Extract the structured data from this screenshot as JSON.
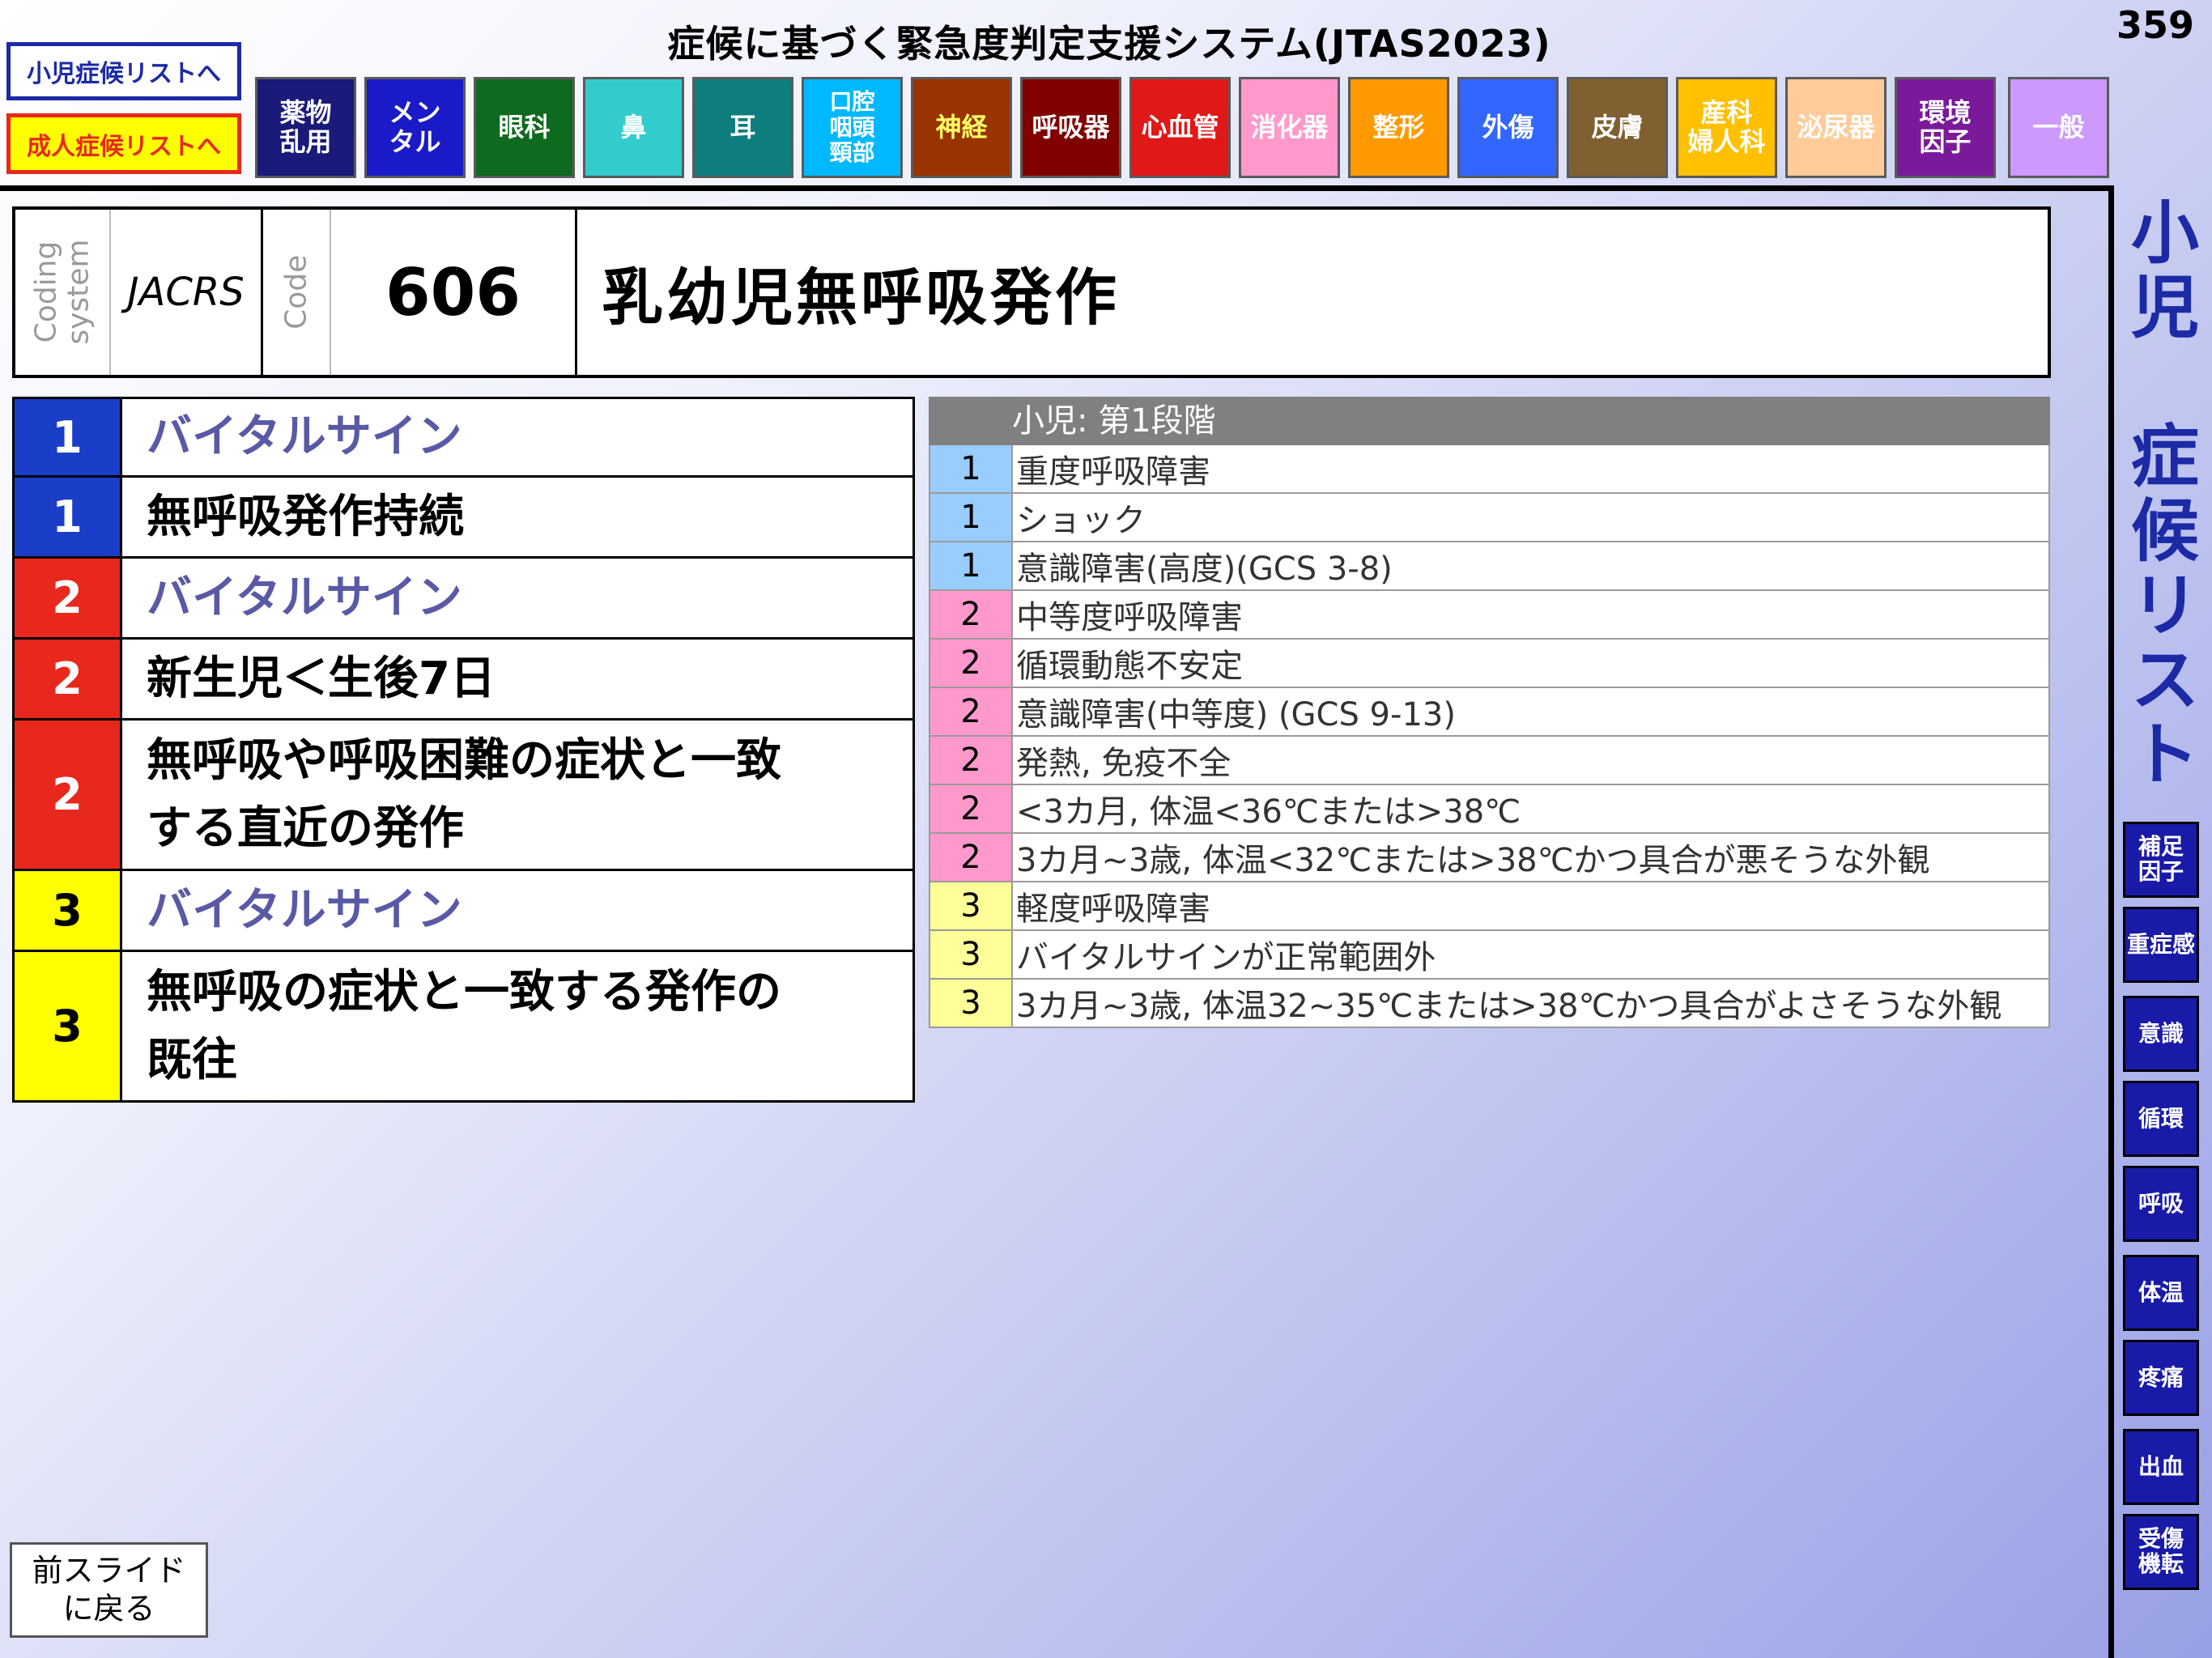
{
  "header": {
    "title": "症候に基づく緊急度判定支援システム(JTAS2023)",
    "slide_number": "359"
  },
  "nav": {
    "child_list": "小児症候リストへ",
    "adult_list": "成人症候リストへ"
  },
  "categories": [
    {
      "label": "薬物\n乱用",
      "bg": "#1a1a7a",
      "fg": "#ffffff"
    },
    {
      "label": "メン\nタル",
      "bg": "#1a1ac8",
      "fg": "#ffffff"
    },
    {
      "label": "眼科",
      "bg": "#0e6a1e",
      "fg": "#ffffff"
    },
    {
      "label": "鼻",
      "bg": "#33cccc",
      "fg": "#ffffff"
    },
    {
      "label": "耳",
      "bg": "#0e7d7d",
      "fg": "#ffffff"
    },
    {
      "label": "口腔\n咽頭\n頸部",
      "bg": "#00b8ff",
      "fg": "#ffffff"
    },
    {
      "label": "神経",
      "bg": "#993300",
      "fg": "#ffff66"
    },
    {
      "label": "呼吸器",
      "bg": "#800000",
      "fg": "#ffffff"
    },
    {
      "label": "心血管",
      "bg": "#e01818",
      "fg": "#ffffff"
    },
    {
      "label": "消化器",
      "bg": "#ff99cc",
      "fg": "#ffffff"
    },
    {
      "label": "整形",
      "bg": "#ff9900",
      "fg": "#ffffff"
    },
    {
      "label": "外傷",
      "bg": "#3366ff",
      "fg": "#ffffff"
    },
    {
      "label": "皮膚",
      "bg": "#806030",
      "fg": "#ffffff"
    },
    {
      "label": "産科\n婦人科",
      "bg": "#ffc000",
      "fg": "#ffffff"
    },
    {
      "label": "泌尿器",
      "bg": "#ffcc99",
      "fg": "#ffffff"
    },
    {
      "label": "環境\n因子",
      "bg": "#7a1a9a",
      "fg": "#ffffff"
    },
    {
      "label": "一般",
      "bg": "#cc99ff",
      "fg": "#ffffff"
    }
  ],
  "side": {
    "title": "小\n児\n\n症\n候\nリ\nス\nト",
    "buttons": [
      "補足\n因子",
      "重症感",
      "意識",
      "循環",
      "呼吸",
      "体温",
      "疼痛",
      "出血",
      "受傷\n機転"
    ]
  },
  "code": {
    "coding_system_label": "Coding\nsystem",
    "system": "JACRS",
    "code_label": "Code",
    "number": "606",
    "complaint": "乳幼児無呼吸発作"
  },
  "criteria": [
    {
      "level": "1",
      "text": "バイタルサイン",
      "vital": true
    },
    {
      "level": "1",
      "text": "無呼吸発作持続",
      "vital": false
    },
    {
      "level": "2",
      "text": "バイタルサイン",
      "vital": true
    },
    {
      "level": "2",
      "text": "新生児＜生後7日",
      "vital": false
    },
    {
      "level": "2",
      "text": "無呼吸や呼吸困難の症状と一致\nする直近の発作",
      "vital": false
    },
    {
      "level": "3",
      "text": "バイタルサイン",
      "vital": true
    },
    {
      "level": "3",
      "text": "無呼吸の症状と一致する発作の\n既往",
      "vital": false
    }
  ],
  "level_colors": {
    "1": "#1a3ec8",
    "2": "#e8281d",
    "3": "#ffff00"
  },
  "modifiers": {
    "header": "小児: 第1段階",
    "rows": [
      {
        "level": "1",
        "text": "重度呼吸障害"
      },
      {
        "level": "1",
        "text": "ショック"
      },
      {
        "level": "1",
        "text": "意識障害(高度)(GCS 3-8)"
      },
      {
        "level": "2",
        "text": "中等度呼吸障害"
      },
      {
        "level": "2",
        "text": "循環動態不安定"
      },
      {
        "level": "2",
        "text": "意識障害(中等度) (GCS 9-13)"
      },
      {
        "level": "2",
        "text": "発熱, 免疫不全"
      },
      {
        "level": "2",
        "text": "<3カ月, 体温<36℃または>38℃"
      },
      {
        "level": "2",
        "text": "3カ月~3歳, 体温<32℃または>38℃かつ具合が悪そうな外観"
      },
      {
        "level": "3",
        "text": "軽度呼吸障害"
      },
      {
        "level": "3",
        "text": "バイタルサインが正常範囲外"
      },
      {
        "level": "3",
        "text": "3カ月~3歳, 体温32~35℃または>38℃かつ具合がよさそうな外観"
      }
    ]
  },
  "modifier_colors": {
    "1": "#99ccff",
    "2": "#ff99cc",
    "3": "#ffff99"
  },
  "back_button": "前スライド\nに戻る"
}
